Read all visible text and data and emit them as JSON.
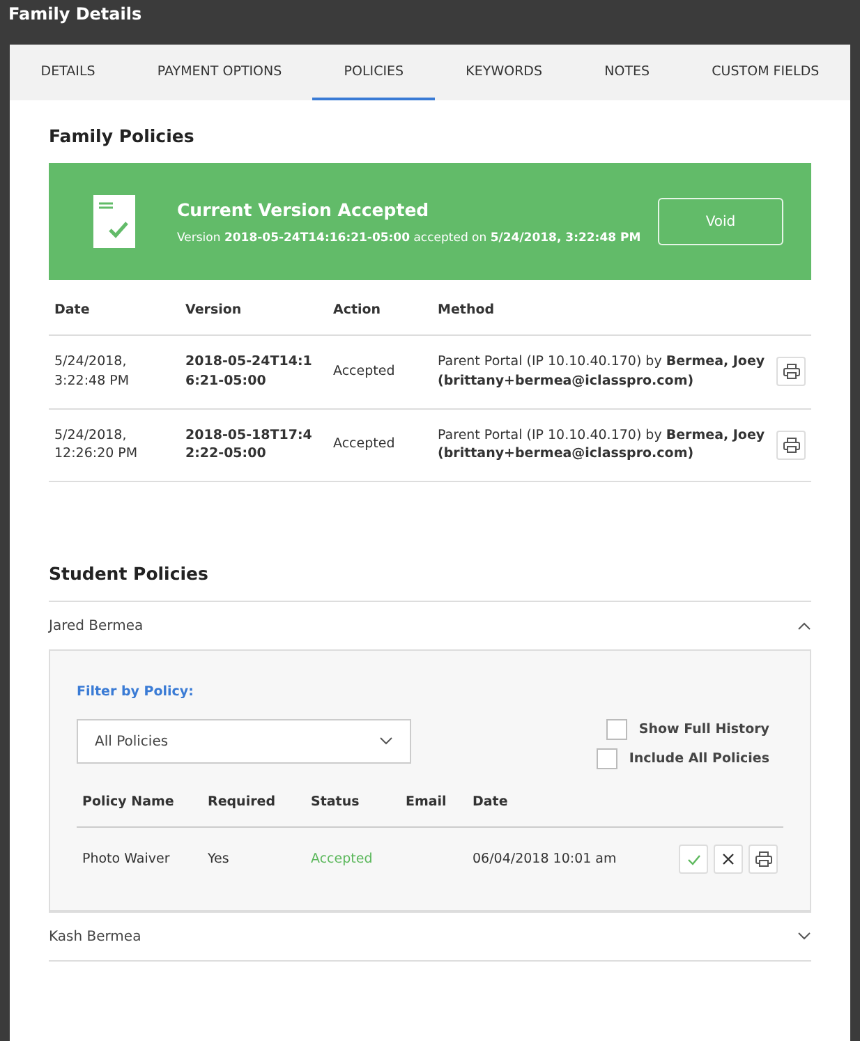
{
  "window": {
    "title": "Family Details"
  },
  "tabs": [
    {
      "label": "DETAILS",
      "selected": false
    },
    {
      "label": "PAYMENT OPTIONS",
      "selected": false
    },
    {
      "label": "POLICIES",
      "selected": true
    },
    {
      "label": "KEYWORDS",
      "selected": false
    },
    {
      "label": "NOTES",
      "selected": false
    },
    {
      "label": "CUSTOM FIELDS",
      "selected": false
    }
  ],
  "family_policies": {
    "heading": "Family Policies",
    "banner": {
      "title": "Current Version Accepted",
      "detail": "Version  **2018-05-24T14:16:21-05:00** accepted on  **5/24/2018, 3:22:48 PM**",
      "button": "Void"
    },
    "columns": [
      "Date",
      "Version",
      "Action",
      "Method"
    ],
    "rows": [
      {
        "date": "5/24/2018, 3:22:48 PM",
        "version": "2018-05-24T14:16:21-05:00",
        "action": "Accepted",
        "method": "Parent Portal (IP 10.10.40.170) by **Bermea, Joey (brittany+bermea@iclasspro.com)**"
      },
      {
        "date": "5/24/2018, 12:26:20 PM",
        "version": "2018-05-18T17:42:22-05:00",
        "action": "Accepted",
        "method": "Parent Portal (IP 10.10.40.170) by **Bermea, Joey (brittany+bermea@iclasspro.com)**"
      }
    ]
  },
  "student_policies": {
    "heading": "Student Policies",
    "students": [
      {
        "name": "Jared Bermea",
        "expanded": true,
        "detail": {
          "filter_label": "Filter by Policy:",
          "select_value": "All Policies",
          "options": [
            {
              "label": "Show Full History",
              "checked": false
            },
            {
              "label": "Include All Policies",
              "checked": false
            }
          ],
          "columns": [
            "Policy Name",
            "Required",
            "Status",
            "Email",
            "Date"
          ],
          "rows": [
            {
              "policy": "Photo Waiver",
              "required": "Yes",
              "status": "Accepted",
              "kind": "accepted",
              "date": "06/04/2018 10:01 am"
            }
          ]
        }
      },
      {
        "name": "Kash Bermea",
        "expanded": false
      }
    ]
  }
}
